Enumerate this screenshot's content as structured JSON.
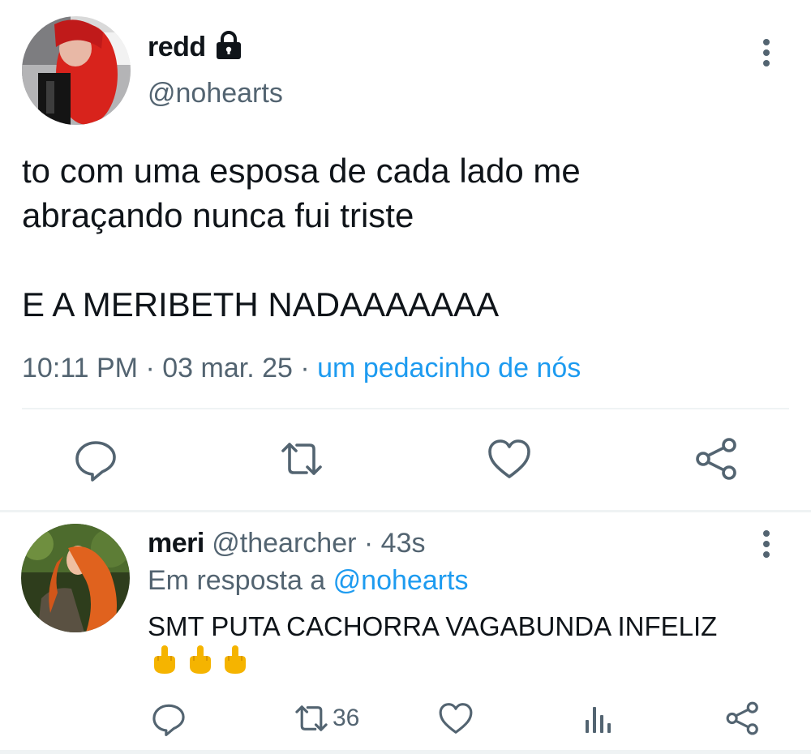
{
  "tweet": {
    "author_name": "redd",
    "handle": "@nohearts",
    "text": "to com uma esposa de cada lado me\nabraçando nunca fui triste\n\nE A MERIBETH NADAAAAAAA",
    "time": "10:11 PM",
    "date": "03 mar. 25",
    "source": "um pedacinho de nós",
    "separator": "·",
    "icons": [
      "lock-icon",
      "more-icon",
      "reply-icon",
      "retweet-icon",
      "like-icon",
      "share-icon"
    ]
  },
  "reply": {
    "author_name": "meri",
    "handle": "@thearcher",
    "age": "43s",
    "reply_prefix": "Em resposta a",
    "reply_target": "@nohearts",
    "text": "SMT PUTA CACHORRA VAGABUNDA INFELIZ",
    "emoji_count": 3,
    "retweet_count": "36",
    "icons": [
      "reply-icon",
      "retweet-icon",
      "like-icon",
      "views-icon",
      "share-icon"
    ]
  },
  "colors": {
    "text": "#0f1419",
    "muted": "#536471",
    "link": "#1d9bf0",
    "divider": "#eff3f4"
  }
}
